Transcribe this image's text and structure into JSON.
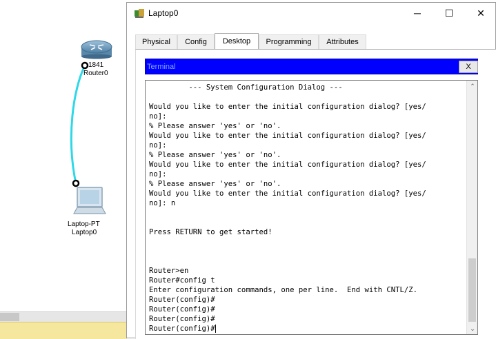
{
  "workspace": {
    "router": {
      "model": "1841",
      "name": "Router0"
    },
    "laptop": {
      "model": "Laptop-PT",
      "name": "Laptop0"
    },
    "link_color": "#2ed8e8"
  },
  "window": {
    "title": "Laptop0",
    "controls": {
      "minimize": "─",
      "maximize": "☐",
      "close": "✕"
    },
    "tabs": [
      "Physical",
      "Config",
      "Desktop",
      "Programming",
      "Attributes"
    ],
    "active_tab": "Desktop"
  },
  "terminal": {
    "title": "Terminal",
    "close_label": "X",
    "header_color": "#0000ff",
    "lines": [
      "         --- System Configuration Dialog ---",
      "",
      "Would you like to enter the initial configuration dialog? [yes/",
      "no]:",
      "% Please answer 'yes' or 'no'.",
      "Would you like to enter the initial configuration dialog? [yes/",
      "no]:",
      "% Please answer 'yes' or 'no'.",
      "Would you like to enter the initial configuration dialog? [yes/",
      "no]:",
      "% Please answer 'yes' or 'no'.",
      "Would you like to enter the initial configuration dialog? [yes/",
      "no]: n",
      "",
      "",
      "Press RETURN to get started!",
      "",
      "",
      "",
      "Router>en",
      "Router#config t",
      "Enter configuration commands, one per line.  End with CNTL/Z.",
      "Router(config)#",
      "Router(config)#",
      "Router(config)#",
      "Router(config)#"
    ],
    "scroll_up": "⌃",
    "scroll_down": "⌄"
  }
}
